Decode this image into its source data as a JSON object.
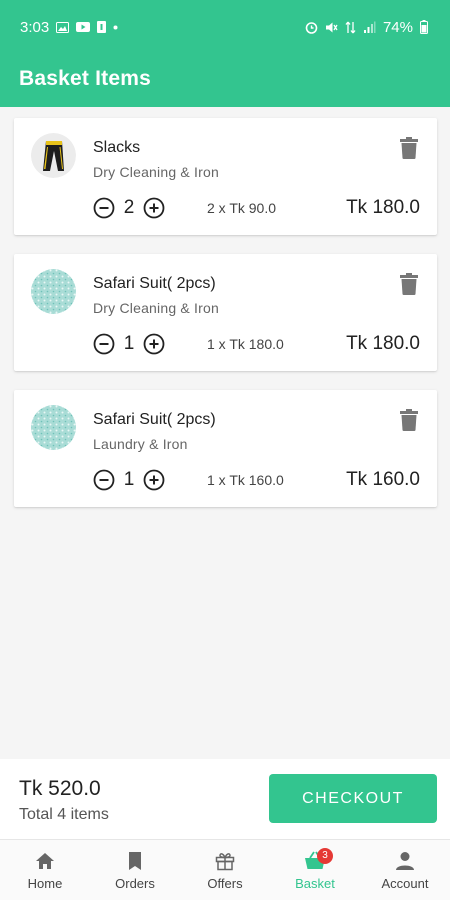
{
  "status_bar": {
    "time": "3:03",
    "battery": "74%"
  },
  "header": {
    "title": "Basket Items"
  },
  "items": [
    {
      "name": "Slacks",
      "service": "Dry Cleaning & Iron",
      "quantity": "2",
      "unit_price": "2 x Tk 90.0",
      "total": "Tk 180.0",
      "thumb": "slacks-image"
    },
    {
      "name": "Safari Suit( 2pcs)",
      "service": "Dry Cleaning & Iron",
      "quantity": "1",
      "unit_price": "1 x Tk 180.0",
      "total": "Tk 180.0",
      "thumb": "safari-suit-image"
    },
    {
      "name": "Safari Suit( 2pcs)",
      "service": "Laundry & Iron",
      "quantity": "1",
      "unit_price": "1 x Tk 160.0",
      "total": "Tk 160.0",
      "thumb": "safari-suit-image"
    }
  ],
  "summary": {
    "total_price": "Tk 520.0",
    "total_items": "Total 4 items",
    "checkout_label": "CHECKOUT"
  },
  "nav": {
    "items": [
      {
        "label": "Home",
        "icon": "home-icon"
      },
      {
        "label": "Orders",
        "icon": "bookmark-icon"
      },
      {
        "label": "Offers",
        "icon": "gift-icon"
      },
      {
        "label": "Basket",
        "icon": "basket-icon",
        "badge": "3",
        "active": true
      },
      {
        "label": "Account",
        "icon": "person-icon"
      }
    ]
  },
  "colors": {
    "accent": "#33c58f",
    "badge": "#e53935"
  }
}
